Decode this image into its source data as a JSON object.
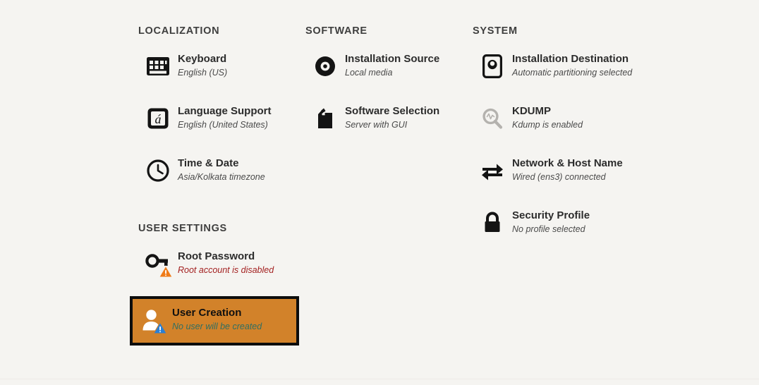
{
  "colors": {
    "background": "#f5f4f1",
    "selected_bg": "#d2822a",
    "selected_outline": "#0d0d0d",
    "warning_text": "#a32020",
    "selected_sub_text": "#2f6f63",
    "icon_dark": "#141414",
    "icon_disabled": "#b4b2ae",
    "badge_orange": "#ef7b18",
    "badge_blue": "#2a7fd4"
  },
  "sections": [
    {
      "id": "localization",
      "title": "LOCALIZATION",
      "items": [
        {
          "icon": "keyboard-icon",
          "title": "Keyboard",
          "subtitle": "English (US)",
          "badge": "none",
          "disabled": false,
          "selected": false
        },
        {
          "icon": "language-support-icon",
          "title": "Language Support",
          "subtitle": "English (United States)",
          "badge": "none",
          "disabled": false,
          "selected": false
        },
        {
          "icon": "clock-icon",
          "title": "Time & Date",
          "subtitle": "Asia/Kolkata timezone",
          "badge": "none",
          "disabled": false,
          "selected": false
        }
      ]
    },
    {
      "id": "software",
      "title": "SOFTWARE",
      "items": [
        {
          "icon": "install-source-icon",
          "title": "Installation Source",
          "subtitle": "Local media",
          "badge": "none",
          "disabled": false,
          "selected": false
        },
        {
          "icon": "package-icon",
          "title": "Software Selection",
          "subtitle": "Server with GUI",
          "badge": "none",
          "disabled": false,
          "selected": false
        }
      ]
    },
    {
      "id": "system",
      "title": "SYSTEM",
      "items": [
        {
          "icon": "hard-drive-icon",
          "title": "Installation Destination",
          "subtitle": "Automatic partitioning selected",
          "badge": "none",
          "disabled": false,
          "selected": false
        },
        {
          "icon": "kdump-search-icon",
          "title": "KDUMP",
          "subtitle": "Kdump is enabled",
          "badge": "none",
          "disabled": true,
          "selected": false
        },
        {
          "icon": "network-icon",
          "title": "Network & Host Name",
          "subtitle": "Wired (ens3) connected",
          "badge": "none",
          "disabled": false,
          "selected": false
        },
        {
          "icon": "lock-icon",
          "title": "Security Profile",
          "subtitle": "No profile selected",
          "badge": "none",
          "disabled": false,
          "selected": false
        }
      ]
    },
    {
      "id": "user-settings",
      "title": "USER SETTINGS",
      "items": [
        {
          "icon": "key-icon",
          "title": "Root Password",
          "subtitle": "Root account is disabled",
          "badge": "warning-orange",
          "disabled": false,
          "selected": false,
          "subtitle_warning": true
        },
        {
          "icon": "user-icon",
          "title": "User Creation",
          "subtitle": "No user will be created",
          "badge": "warning-blue",
          "disabled": false,
          "selected": true
        }
      ]
    }
  ]
}
